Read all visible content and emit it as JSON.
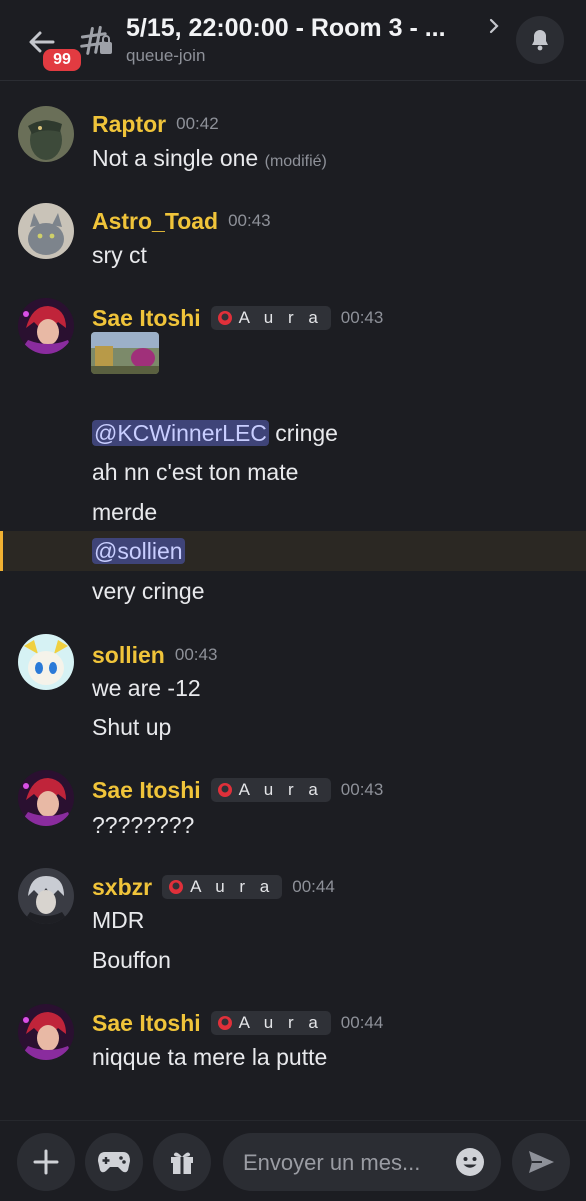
{
  "header": {
    "unread_count": "99",
    "title": "5/15, 22:00:00 - Room 3 - ...",
    "subtitle": "queue-join"
  },
  "messages": [
    {
      "author": "Raptor",
      "time": "00:42",
      "lines": [
        "Not a single one"
      ],
      "edited": "(modifié)"
    },
    {
      "author": "Astro_Toad",
      "time": "00:43",
      "lines": [
        "sry ct"
      ]
    },
    {
      "author": "Sae Itoshi",
      "tag": "A u r a",
      "time": "00:43",
      "lines": {
        "mention1": "@KCWinnerLEC",
        "after1": " cringe",
        "l2": "ah nn c'est ton mate",
        "l3": "merde",
        "mention2": "@sollien",
        "l5": "very cringe"
      }
    },
    {
      "author": "sollien",
      "time": "00:43",
      "lines": [
        "we are -12",
        "Shut up"
      ]
    },
    {
      "author": "Sae Itoshi",
      "tag": "A u r a",
      "time": "00:43",
      "lines": [
        "????????"
      ]
    },
    {
      "author": "sxbzr",
      "tag": "A u r a",
      "time": "00:44",
      "lines": [
        "MDR",
        "Bouffon"
      ]
    },
    {
      "author": "Sae Itoshi",
      "tag": "A u r a",
      "time": "00:44",
      "lines": [
        "niqque ta mere la putte"
      ]
    }
  ],
  "composer": {
    "placeholder": "Envoyer un mes..."
  },
  "colors": {
    "username": "#f0c43a",
    "mention_bg": "#3f4478",
    "highlight_bar": "#f0b132",
    "badge": "#e23b41"
  },
  "icons": [
    "back-arrow-icon",
    "text-channel-icon",
    "chevron-right-icon",
    "bell-icon",
    "plus-icon",
    "gamepad-icon",
    "gift-icon",
    "emoji-icon",
    "send-icon"
  ]
}
